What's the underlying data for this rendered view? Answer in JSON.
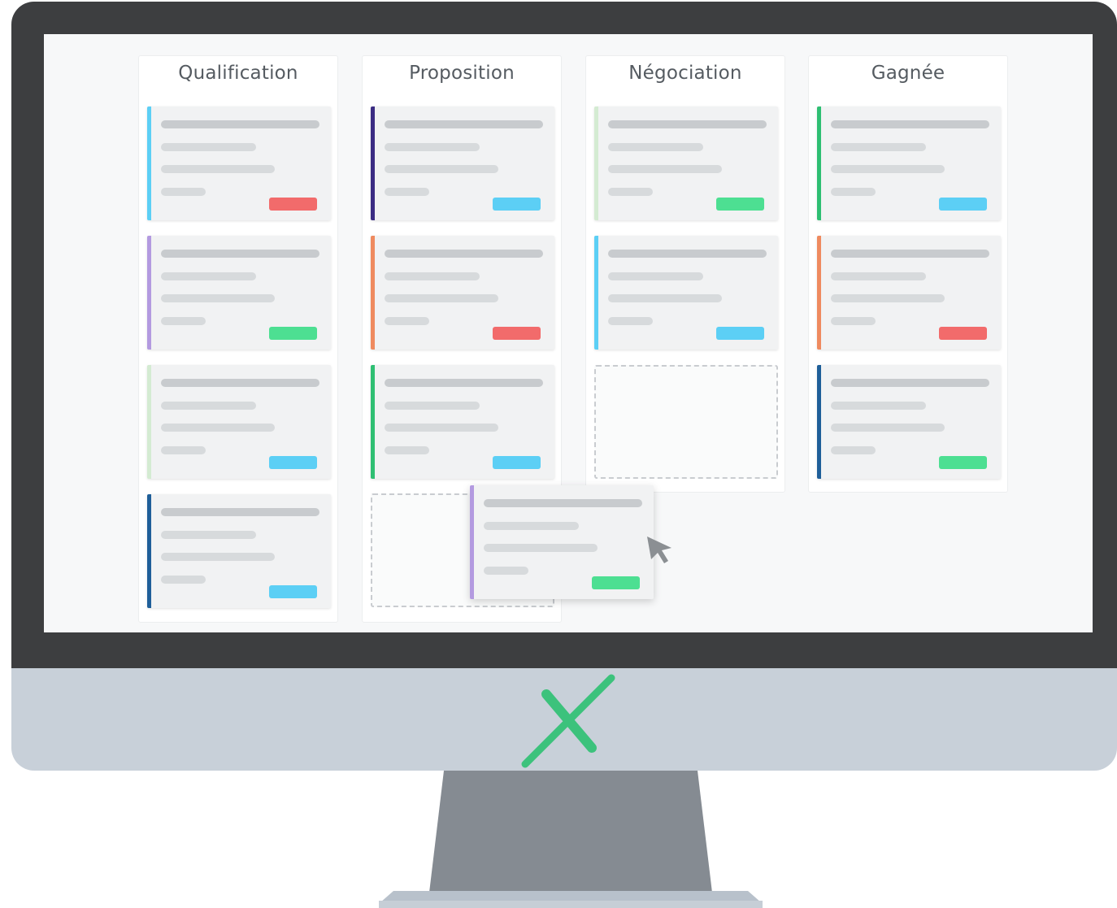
{
  "colors": {
    "cyan": "#5ccff5",
    "purple": "#3b2c83",
    "lavender": "#b39ae0",
    "orange": "#ef8a5f",
    "green": "#2fbf73",
    "lightgreen": "#d4ebd2",
    "navy": "#1f5f99",
    "tag_red": "#f26b6b",
    "tag_green": "#4ddf92",
    "tag_blue": "#5ccff5",
    "logo_green": "#3cc27c"
  },
  "board": {
    "columns": [
      {
        "title": "Qualification",
        "cards": [
          {
            "accent": "cyan",
            "tag": "tag_red"
          },
          {
            "accent": "lavender",
            "tag": "tag_green"
          },
          {
            "accent": "lightgreen",
            "tag": "tag_blue"
          },
          {
            "accent": "navy",
            "tag": "tag_blue"
          }
        ]
      },
      {
        "title": "Proposition",
        "cards": [
          {
            "accent": "purple",
            "tag": "tag_blue"
          },
          {
            "accent": "orange",
            "tag": "tag_red"
          },
          {
            "accent": "green",
            "tag": "tag_blue"
          }
        ],
        "placeholder": true
      },
      {
        "title": "Négociation",
        "cards": [
          {
            "accent": "lightgreen",
            "tag": "tag_green"
          },
          {
            "accent": "cyan",
            "tag": "tag_blue"
          }
        ],
        "placeholder": true
      },
      {
        "title": "Gagnée",
        "cards": [
          {
            "accent": "green",
            "tag": "tag_blue"
          },
          {
            "accent": "orange",
            "tag": "tag_red"
          },
          {
            "accent": "navy",
            "tag": "tag_green"
          }
        ]
      }
    ],
    "dragged_card": {
      "accent": "lavender",
      "tag": "tag_green"
    }
  },
  "icons": {
    "cursor": "arrow-cursor-icon",
    "logo": "x-logo-icon"
  }
}
